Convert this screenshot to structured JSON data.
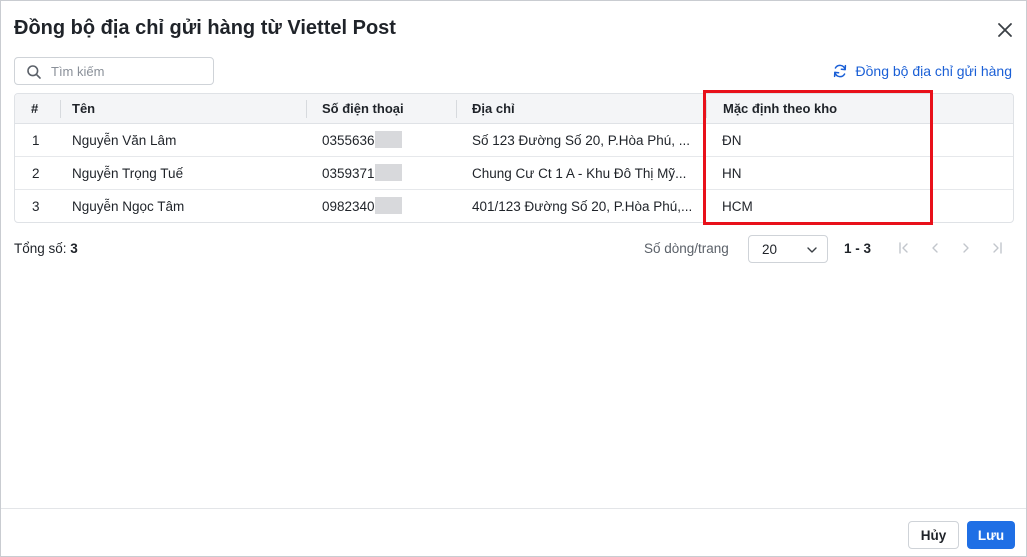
{
  "dialog": {
    "title": "Đồng bộ địa chỉ gửi hàng từ Viettel Post"
  },
  "search": {
    "placeholder": "Tìm kiếm",
    "value": ""
  },
  "sync_link": {
    "label": "Đồng bộ địa chỉ gửi hàng",
    "icon": "refresh-icon"
  },
  "table": {
    "columns": [
      "#",
      "Tên",
      "Số điện thoại",
      "Địa chỉ",
      "Mặc định theo kho"
    ],
    "rows": [
      {
        "index": "1",
        "name": "Nguyễn Văn Lâm",
        "phone": "0355636",
        "address": "Số 123 Đường Số 20, P.Hòa Phú, ...",
        "warehouse": "ĐN"
      },
      {
        "index": "2",
        "name": "Nguyễn Trọng Tuế",
        "phone": "0359371",
        "address": "Chung Cư Ct 1 A - Khu Đô Thị Mỹ...",
        "warehouse": "HN"
      },
      {
        "index": "3",
        "name": "Nguyễn Ngọc Tâm",
        "phone": "0982340",
        "address": "401/123 Đường Số 20, P.Hòa Phú,...",
        "warehouse": "HCM"
      }
    ]
  },
  "summary": {
    "total_label": "Tổng số:",
    "total_value": "3"
  },
  "pagination": {
    "rows_per_page_label": "Số dòng/trang",
    "rows_per_page": "20",
    "range": "1 - 3"
  },
  "footer": {
    "cancel_label": "Hủy",
    "save_label": "Lưu"
  },
  "colors": {
    "accent": "#1f6fe5",
    "link": "#1a5fd6",
    "highlight": "#e8101a"
  }
}
